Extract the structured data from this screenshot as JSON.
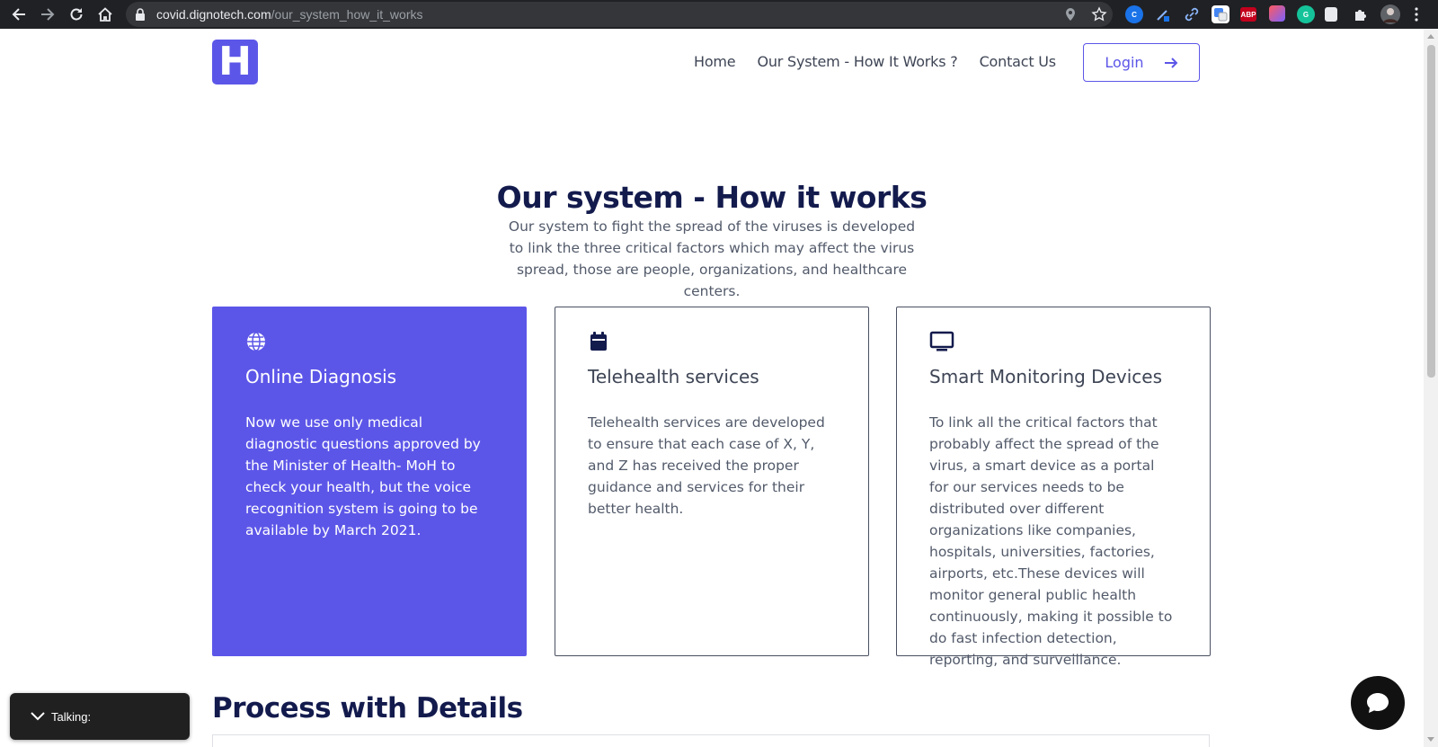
{
  "browser": {
    "url_host": "covid.dignotech.com",
    "url_path": "/our_system_how_it_works",
    "extensions": [
      {
        "name": "abp",
        "label": "ABP",
        "color": "#c4001d"
      }
    ]
  },
  "header": {
    "logo_letter": "H",
    "nav": [
      "Home",
      "Our System - How It Works ?",
      "Contact Us"
    ],
    "login_label": "Login"
  },
  "intro": {
    "title": "Our system - How it works",
    "description": "Our system to fight the spread of the viruses is developed to link the three critical factors which may affect the virus spread, those are people, organizations, and healthcare centers."
  },
  "cards": [
    {
      "icon": "globe-icon",
      "title": "Online Diagnosis",
      "text": "Now we use only medical diagnostic questions approved by the Minister of Health- MoH to check your health, but the voice recognition system is going to be available by March 2021."
    },
    {
      "icon": "calendar-icon",
      "title": "Telehealth services",
      "text": "Telehealth services are developed to ensure that each case of X, Y, and Z has received the proper guidance and services for their better health."
    },
    {
      "icon": "monitor-icon",
      "title": "Smart Monitoring Devices",
      "text": "To link all the critical factors that probably affect the spread of the virus, a smart device as a portal for our services needs to be distributed over different organizations like companies, hospitals, universities, factories, airports, etc.These devices will monitor general public health continuously, making it possible to do fast infection detection, reporting, and surveillance."
    }
  ],
  "process": {
    "title": "Process with Details"
  },
  "widgets": {
    "talking_label": "Talking:"
  },
  "colors": {
    "accent": "#5c56e8",
    "heading": "#131b4d",
    "text": "#525a6a"
  }
}
